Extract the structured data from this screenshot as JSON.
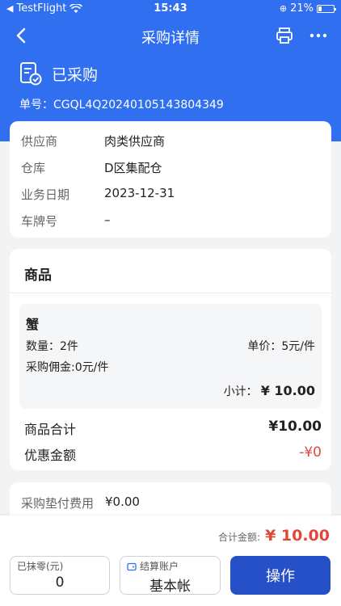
{
  "status_bar": {
    "carrier": "TestFlight",
    "time": "15:43",
    "battery": "21%"
  },
  "nav": {
    "title": "采购详情"
  },
  "header": {
    "status": "已采购",
    "order_no": "单号：CGQL4Q20240105143804349"
  },
  "info": {
    "rows": [
      {
        "label": "供应商",
        "value": "肉类供应商"
      },
      {
        "label": "仓库",
        "value": "D区集配仓"
      },
      {
        "label": "业务日期",
        "value": "2023-12-31"
      },
      {
        "label": "车牌号",
        "value": "–"
      }
    ]
  },
  "goods": {
    "title": "商品",
    "item": {
      "name": "蟹",
      "qty": "数量：2件",
      "unit_price": "单价：5元/件",
      "commission": "采购佣金:0元/件",
      "subtotal_label": "小计：",
      "subtotal_value": "¥ 10.00"
    },
    "total_label": "商品合计",
    "total_value": "¥10.00",
    "discount_label": "优惠金额",
    "discount_value": "-¥0"
  },
  "fee": {
    "label": "采购垫付费用",
    "value": "¥0.00"
  },
  "bottom": {
    "total_label": "合计金额:",
    "total_value": "¥ 10.00",
    "zero_label": "已抹零(元)",
    "zero_value": "0",
    "account_label": "结算账户",
    "account_value": "基本帐",
    "action_label": "操作"
  },
  "colors": {
    "primary": "#2f6ff0",
    "button": "#2650c8",
    "accent_red": "#e2473a"
  }
}
